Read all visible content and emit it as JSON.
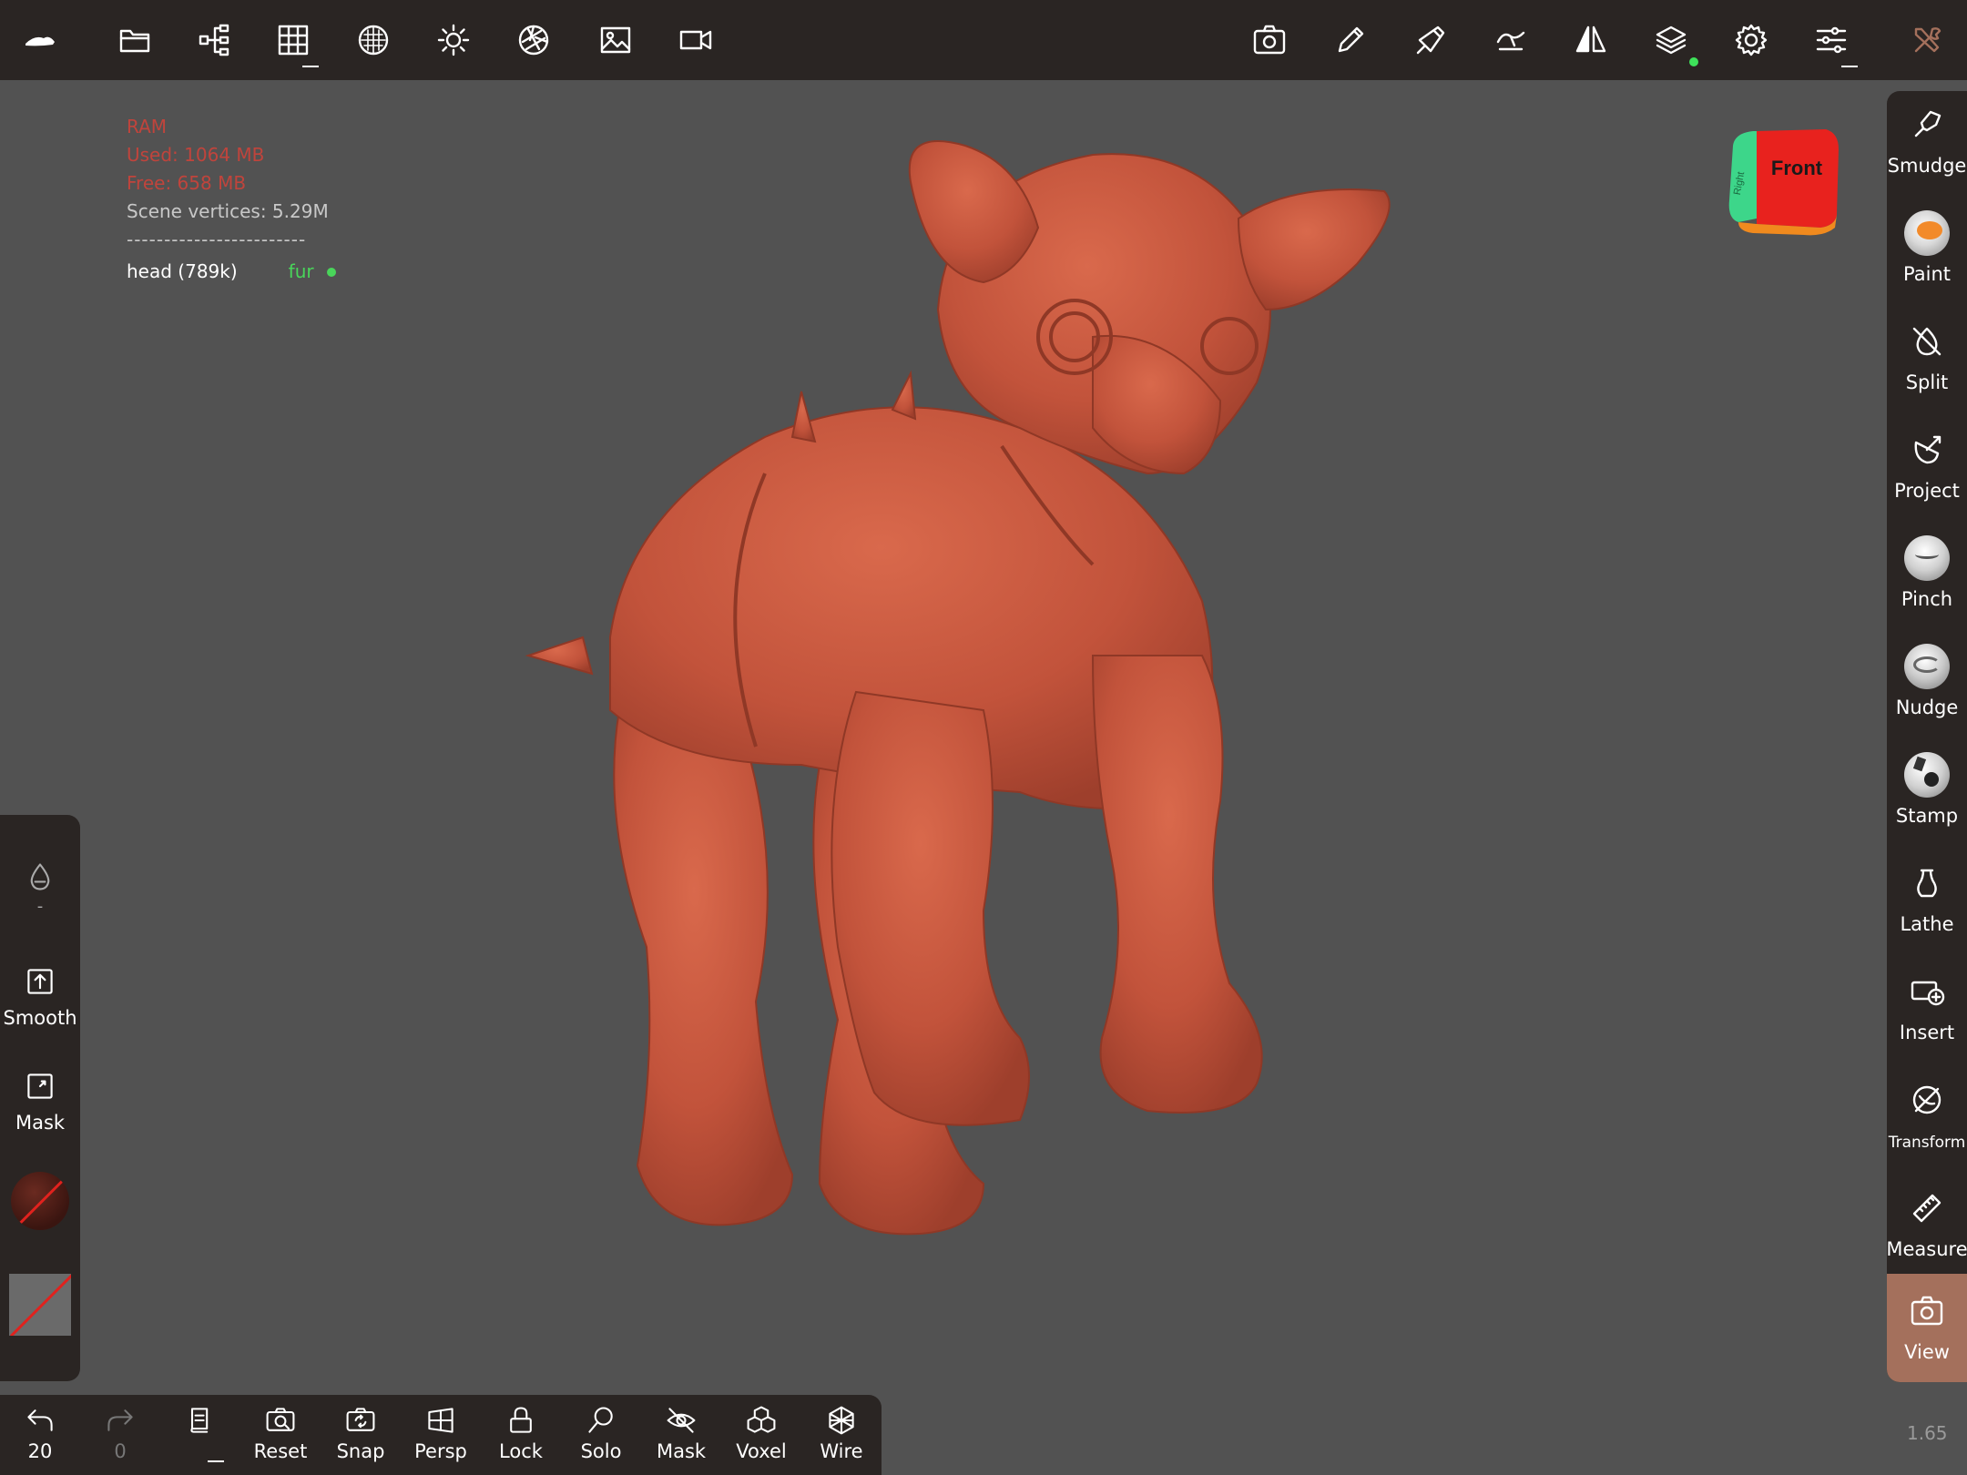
{
  "topbar": {
    "left_icons": [
      "app-logo-icon",
      "folder-icon",
      "scene-tree-icon",
      "grid-icon",
      "sphere-icon",
      "sun-icon",
      "aperture-icon",
      "image-icon",
      "video-icon"
    ],
    "right_icons": [
      "camera-icon",
      "pencil-icon",
      "brush-icon",
      "stroke-icon",
      "symmetry-icon",
      "layers-icon",
      "settings-icon",
      "sliders-icon",
      "tools-icon"
    ]
  },
  "stats": {
    "ram_label": "RAM",
    "used": "Used: 1064 MB",
    "free": "Free: 658 MB",
    "vertices": "Scene vertices: 5.29M",
    "separator": "------------------------",
    "object_name": "head (789k)",
    "object_tag": "fur"
  },
  "view_cube": {
    "front_label": "Front",
    "right_label": "Right",
    "colors": {
      "front": "#e8221e",
      "right": "#3dd68a",
      "bottom": "#f08a1e"
    }
  },
  "right_tools": [
    {
      "label": "Smudge",
      "icon": "smudge-icon"
    },
    {
      "label": "Paint",
      "icon": "paint-ball-icon"
    },
    {
      "label": "Split",
      "icon": "split-icon"
    },
    {
      "label": "Project",
      "icon": "project-icon"
    },
    {
      "label": "Pinch",
      "icon": "pinch-ball-icon"
    },
    {
      "label": "Nudge",
      "icon": "nudge-ball-icon"
    },
    {
      "label": "Stamp",
      "icon": "stamp-ball-icon"
    },
    {
      "label": "Lathe",
      "icon": "lathe-icon"
    },
    {
      "label": "Insert",
      "icon": "insert-icon"
    },
    {
      "label": "Transform",
      "icon": "transform-icon"
    },
    {
      "label": "Measure",
      "icon": "ruler-icon"
    },
    {
      "label": "View",
      "icon": "camera-icon",
      "active": true
    }
  ],
  "left_panel": {
    "drop_value": "-",
    "smooth_label": "Smooth",
    "mask_label": "Mask"
  },
  "bottombar": {
    "undo_count": "20",
    "redo_count": "0",
    "reset_label": "Reset",
    "snap_label": "Snap",
    "persp_label": "Persp",
    "lock_label": "Lock",
    "solo_label": "Solo",
    "mask_label": "Mask",
    "voxel_label": "Voxel",
    "wire_label": "Wire"
  },
  "zoom_value": "1.65",
  "colors": {
    "accent": "#a4705c",
    "panel": "#2a2523",
    "viewport": "#525252",
    "model": "#c8573e",
    "status_green": "#49d55a"
  }
}
